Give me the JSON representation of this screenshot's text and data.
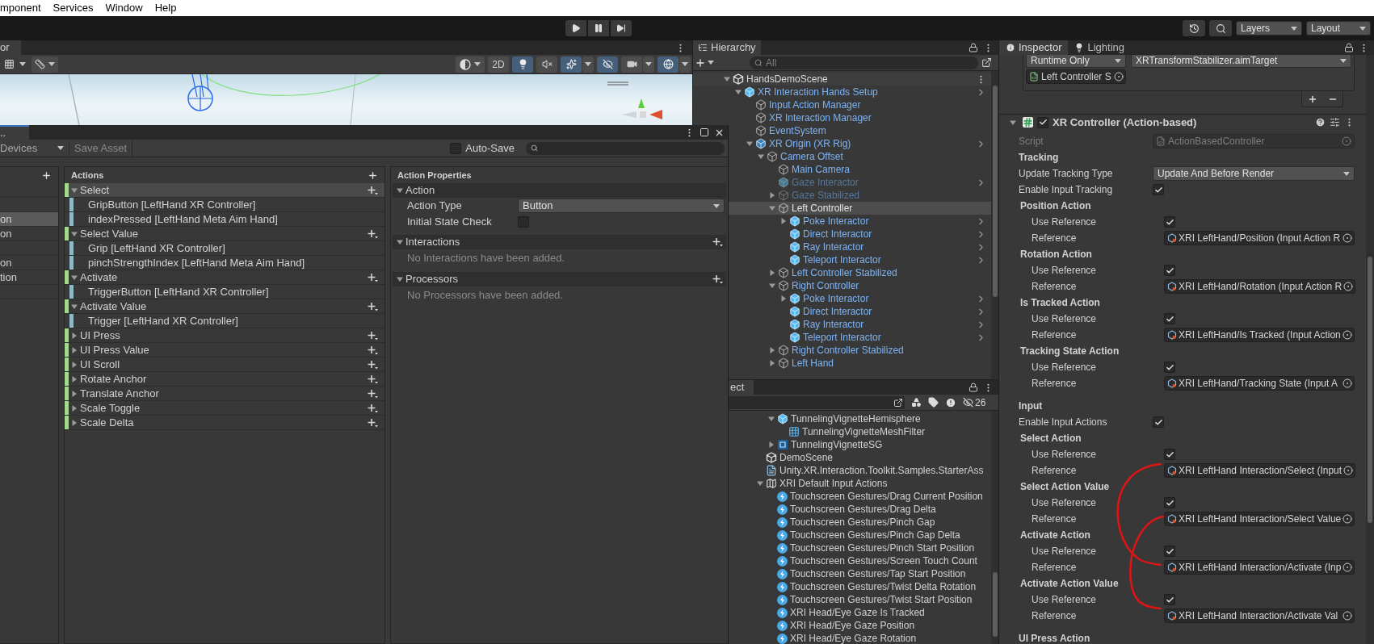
{
  "menu_bar": [
    "mponent",
    "Services",
    "Window",
    "Help"
  ],
  "toolbar": {
    "layers": "Layers",
    "layout": "Layout"
  },
  "scene": {
    "tab": "or",
    "tools": [
      {
        "kind": "shading",
        "selected": false
      },
      {
        "kind": "mode_2d",
        "label": "2D",
        "selected": false
      },
      {
        "kind": "lighting",
        "selected": true
      },
      {
        "kind": "audio",
        "selected": false
      },
      {
        "kind": "effects",
        "selected": true
      },
      {
        "kind": "visibility",
        "selected": true
      },
      {
        "kind": "camera",
        "selected": false
      },
      {
        "kind": "gizmos",
        "selected": true
      }
    ]
  },
  "input_actions": {
    "tab": "..",
    "devices": "Devices",
    "save_asset": {
      "label": "Save Asset",
      "disabled": true
    },
    "auto_save": {
      "label": "Auto-Save",
      "checked": false
    },
    "action_maps": [
      {
        "selected": false
      },
      {
        "selected": false
      },
      {
        "label": "on",
        "selected": true
      },
      {
        "label": "on",
        "selected": false
      },
      {
        "selected": false
      },
      {
        "label": "on",
        "selected": false
      },
      {
        "label": "tion",
        "selected": false
      },
      {
        "selected": false
      }
    ],
    "actions": {
      "title": "Actions",
      "items": [
        {
          "label": "Select",
          "expanded": true,
          "selected": true,
          "children": [
            {
              "label": "GripButton [LeftHand XR Controller]",
              "selected": false
            },
            {
              "label": "indexPressed [LeftHand Meta Aim Hand]",
              "selected": false
            }
          ]
        },
        {
          "label": "Select Value",
          "expanded": true,
          "selected": false,
          "children": [
            {
              "label": "Grip [LeftHand XR Controller]",
              "selected": false
            },
            {
              "label": "pinchStrengthIndex [LeftHand Meta Aim Hand]",
              "selected": false
            }
          ]
        },
        {
          "label": "Activate",
          "expanded": true,
          "selected": false,
          "children": [
            {
              "label": "TriggerButton [LeftHand XR Controller]",
              "selected": false
            }
          ]
        },
        {
          "label": "Activate Value",
          "expanded": true,
          "selected": false,
          "children": [
            {
              "label": "Trigger [LeftHand XR Controller]",
              "selected": false
            }
          ]
        },
        {
          "label": "UI Press",
          "expanded": false,
          "selected": false
        },
        {
          "label": "UI Press Value",
          "expanded": false,
          "selected": false
        },
        {
          "label": "UI Scroll",
          "expanded": false,
          "selected": false
        },
        {
          "label": "Rotate Anchor",
          "expanded": false,
          "selected": false
        },
        {
          "label": "Translate Anchor",
          "expanded": false,
          "selected": false
        },
        {
          "label": "Scale Toggle",
          "expanded": false,
          "selected": false
        },
        {
          "label": "Scale Delta",
          "expanded": false,
          "selected": false
        }
      ]
    },
    "properties": {
      "title": "Action Properties",
      "sections": [
        {
          "title": "Action",
          "expanded": true,
          "fields": [
            {
              "kind": "dropdown",
              "label": "Action Type",
              "value": "Button"
            },
            {
              "kind": "checkbox",
              "label": "Initial State Check",
              "checked": false
            }
          ]
        },
        {
          "title": "Interactions",
          "expanded": true,
          "empty_text": "No Interactions have been added."
        },
        {
          "title": "Processors",
          "expanded": true,
          "empty_text": "No Processors have been added."
        }
      ]
    }
  },
  "hierarchy": {
    "tab": "Hierarchy",
    "search_placeholder": "All",
    "tree": [
      {
        "label": "HandsDemoScene",
        "kind": "scene",
        "expanded": true,
        "selected": false,
        "disabled": false,
        "children": [
          {
            "label": "XR Interaction Hands Setup",
            "kind": "prefab",
            "expanded": true,
            "selected": false,
            "disabled": false,
            "children": [
              {
                "label": "Input Action Manager",
                "kind": "object",
                "selected": false,
                "disabled": false
              },
              {
                "label": "XR Interaction Manager",
                "kind": "object",
                "selected": false,
                "disabled": false
              },
              {
                "label": "EventSystem",
                "kind": "object",
                "selected": false,
                "disabled": false
              },
              {
                "label": "XR Origin (XR Rig)",
                "kind": "prefab_variant",
                "expanded": true,
                "selected": false,
                "disabled": false,
                "children": [
                  {
                    "label": "Camera Offset",
                    "kind": "object",
                    "expanded": true,
                    "selected": false,
                    "disabled": false,
                    "children": [
                      {
                        "label": "Main Camera",
                        "kind": "object",
                        "selected": false,
                        "disabled": false
                      },
                      {
                        "label": "Gaze Interactor",
                        "kind": "prefab",
                        "selected": false,
                        "disabled": true
                      },
                      {
                        "label": "Gaze Stabilized",
                        "kind": "object",
                        "expanded": false,
                        "selected": false,
                        "disabled": true
                      },
                      {
                        "label": "Left Controller",
                        "kind": "object",
                        "expanded": true,
                        "selected": true,
                        "disabled": false,
                        "children": [
                          {
                            "label": "Poke Interactor",
                            "kind": "prefab",
                            "expanded": false,
                            "selected": false,
                            "disabled": false
                          },
                          {
                            "label": "Direct Interactor",
                            "kind": "prefab",
                            "selected": false,
                            "disabled": false
                          },
                          {
                            "label": "Ray Interactor",
                            "kind": "prefab",
                            "selected": false,
                            "disabled": false
                          },
                          {
                            "label": "Teleport Interactor",
                            "kind": "prefab",
                            "selected": false,
                            "disabled": false
                          }
                        ]
                      },
                      {
                        "label": "Left Controller Stabilized",
                        "kind": "object",
                        "expanded": false,
                        "selected": false,
                        "disabled": false
                      },
                      {
                        "label": "Right Controller",
                        "kind": "object",
                        "expanded": true,
                        "selected": false,
                        "disabled": false,
                        "children": [
                          {
                            "label": "Poke Interactor",
                            "kind": "prefab",
                            "expanded": false,
                            "selected": false,
                            "disabled": false
                          },
                          {
                            "label": "Direct Interactor",
                            "kind": "prefab",
                            "selected": false,
                            "disabled": false
                          },
                          {
                            "label": "Ray Interactor",
                            "kind": "prefab",
                            "selected": false,
                            "disabled": false
                          },
                          {
                            "label": "Teleport Interactor",
                            "kind": "prefab",
                            "selected": false,
                            "disabled": false
                          }
                        ]
                      },
                      {
                        "label": "Right Controller Stabilized",
                        "kind": "object",
                        "expanded": false,
                        "selected": false,
                        "disabled": false
                      },
                      {
                        "label": "Left Hand",
                        "kind": "object",
                        "expanded": false,
                        "selected": false,
                        "disabled": false
                      }
                    ]
                  }
                ]
              }
            ]
          }
        ]
      }
    ]
  },
  "project": {
    "tab": "ect",
    "hidden_count": "26",
    "items": [
      {
        "kind": "hidden",
        "children": [
          {
            "label": "TunnelingVignetteHemisphere",
            "kind": "prefab",
            "expanded": true,
            "selected": false,
            "children": [
              {
                "label": "TunnelingVignetteMeshFilter",
                "kind": "mesh",
                "selected": false
              }
            ]
          },
          {
            "label": "TunnelingVignetteSG",
            "kind": "shader",
            "expanded": false,
            "selected": false
          }
        ]
      },
      {
        "label": "DemoScene",
        "kind": "scene",
        "selected": false
      },
      {
        "label": "Unity.XR.Interaction.Toolkit.Samples.StarterAss",
        "kind": "assembly",
        "selected": false
      },
      {
        "label": "XRI Default Input Actions",
        "kind": "input_actions",
        "expanded": true,
        "selected": false,
        "children": [
          {
            "label": "Touchscreen Gestures/Drag Current Position",
            "kind": "action",
            "selected": false
          },
          {
            "label": "Touchscreen Gestures/Drag Delta",
            "kind": "action",
            "selected": false
          },
          {
            "label": "Touchscreen Gestures/Pinch Gap",
            "kind": "action",
            "selected": false
          },
          {
            "label": "Touchscreen Gestures/Pinch Gap Delta",
            "kind": "action",
            "selected": false
          },
          {
            "label": "Touchscreen Gestures/Pinch Start Position",
            "kind": "action",
            "selected": false
          },
          {
            "label": "Touchscreen Gestures/Screen Touch Count",
            "kind": "action",
            "selected": false
          },
          {
            "label": "Touchscreen Gestures/Tap Start Position",
            "kind": "action",
            "selected": false
          },
          {
            "label": "Touchscreen Gestures/Twist Delta Rotation",
            "kind": "action",
            "selected": false
          },
          {
            "label": "Touchscreen Gestures/Twist Start Position",
            "kind": "action",
            "selected": false
          },
          {
            "label": "XRI Head/Eye Gaze Is Tracked",
            "kind": "action",
            "selected": false
          },
          {
            "label": "XRI Head/Eye Gaze Position",
            "kind": "action",
            "selected": false
          },
          {
            "label": "XRI Head/Eye Gaze Rotation",
            "kind": "action",
            "selected": false
          }
        ]
      }
    ]
  },
  "inspector": {
    "tabs": [
      {
        "label": "Inspector",
        "kind": "info",
        "selected": true
      },
      {
        "label": "Lighting",
        "kind": "light",
        "selected": false
      }
    ],
    "event": {
      "mode": "Runtime Only",
      "function": "XRTransformStabilizer.aimTarget",
      "target": "Left Controller S"
    },
    "component": {
      "title": "XR Controller (Action-based)",
      "enabled": true,
      "expanded": true,
      "rows": [
        {
          "kind": "script",
          "label": "Script",
          "value": "ActionBasedController",
          "disabled": true
        },
        {
          "kind": "heading",
          "label": "Tracking"
        },
        {
          "kind": "dropdown",
          "label": "Update Tracking Type",
          "value": "Update And Before Render"
        },
        {
          "kind": "toggle",
          "label": "Enable Input Tracking",
          "checked": true
        },
        {
          "kind": "group",
          "label": "Position Action",
          "children": [
            {
              "kind": "toggle",
              "label": "Use Reference",
              "checked": true
            },
            {
              "kind": "reference",
              "label": "Reference",
              "value": "XRI LeftHand/Position (Input Action R"
            }
          ]
        },
        {
          "kind": "group",
          "label": "Rotation Action",
          "children": [
            {
              "kind": "toggle",
              "label": "Use Reference",
              "checked": true
            },
            {
              "kind": "reference",
              "label": "Reference",
              "value": "XRI LeftHand/Rotation (Input Action R"
            }
          ]
        },
        {
          "kind": "group",
          "label": "Is Tracked Action",
          "children": [
            {
              "kind": "toggle",
              "label": "Use Reference",
              "checked": true
            },
            {
              "kind": "reference",
              "label": "Reference",
              "value": "XRI LeftHand/Is Tracked (Input Action"
            }
          ]
        },
        {
          "kind": "group",
          "label": "Tracking State Action",
          "children": [
            {
              "kind": "toggle",
              "label": "Use Reference",
              "checked": true
            },
            {
              "kind": "reference",
              "label": "Reference",
              "value": "XRI LeftHand/Tracking State (Input A"
            }
          ]
        },
        {
          "kind": "heading",
          "label": "Input"
        },
        {
          "kind": "toggle",
          "label": "Enable Input Actions",
          "checked": true
        },
        {
          "kind": "group",
          "label": "Select Action",
          "children": [
            {
              "kind": "toggle",
              "label": "Use Reference",
              "checked": true
            },
            {
              "kind": "reference",
              "label": "Reference",
              "value": "XRI LeftHand Interaction/Select (Input"
            }
          ]
        },
        {
          "kind": "group",
          "label": "Select Action Value",
          "children": [
            {
              "kind": "toggle",
              "label": "Use Reference",
              "checked": true
            },
            {
              "kind": "reference",
              "label": "Reference",
              "value": "XRI LeftHand Interaction/Select Value"
            }
          ]
        },
        {
          "kind": "group",
          "label": "Activate Action",
          "children": [
            {
              "kind": "toggle",
              "label": "Use Reference",
              "checked": true
            },
            {
              "kind": "reference",
              "label": "Reference",
              "value": "XRI LeftHand Interaction/Activate (Inp"
            }
          ]
        },
        {
          "kind": "group",
          "label": "Activate Action Value",
          "children": [
            {
              "kind": "toggle",
              "label": "Use Reference",
              "checked": true
            },
            {
              "kind": "reference",
              "label": "Reference",
              "value": "XRI LeftHand Interaction/Activate Val"
            }
          ]
        },
        {
          "kind": "heading",
          "label": "UI Press Action"
        }
      ]
    }
  }
}
